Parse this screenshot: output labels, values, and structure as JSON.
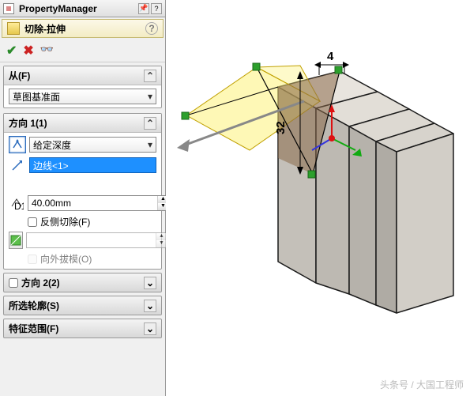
{
  "titlebar": {
    "title": "PropertyManager"
  },
  "feature": {
    "name": "切除-拉伸",
    "help": "?"
  },
  "confirm": {
    "ok": "✔",
    "cancel": "✖",
    "detail": "👓"
  },
  "sections": {
    "from": {
      "header": "从(F)",
      "plane": "草图基准面"
    },
    "dir1": {
      "header": "方向 1(1)",
      "endcond": "给定深度",
      "edge_ref": "边线<1>",
      "depth": "40.00mm",
      "flip_label": "反侧切除(F)",
      "draft_label": "向外拔模(O)"
    },
    "dir2": {
      "header": "方向 2(2)"
    },
    "contours": {
      "header": "所选轮廓(S)"
    },
    "scope": {
      "header": "特征范围(F)"
    }
  },
  "dims": {
    "d1": "32",
    "d2": "4"
  },
  "watermark": "头条号 / 大国工程师"
}
